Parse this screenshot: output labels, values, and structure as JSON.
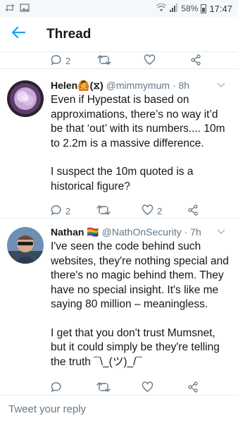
{
  "status_bar": {
    "battery": "58%",
    "time": "17:47"
  },
  "header": {
    "title": "Thread"
  },
  "top_actions": {
    "reply_count": "2"
  },
  "tweets": [
    {
      "display_name": "Helen",
      "name_suffix": "(⧖)",
      "handle": "@mimmymum",
      "time": "· 8h",
      "paragraphs": [
        "Even if Hypestat is based on approximations, there’s no way it’d be that ‘out’ with its numbers.... 10m to 2.2m is a massive difference.",
        "I suspect the 10m quoted is a historical figure?"
      ],
      "reply_count": "2",
      "like_count": "2"
    },
    {
      "display_name": "Nathan",
      "name_suffix": "🏳️‍🌈",
      "handle": "@NathOnSecurity",
      "time": "· 7h",
      "paragraphs": [
        "I've seen the code behind such websites, they're nothing special and there's no magic behind them. They have no special insight. It's like me saying 80 million – meaningless.",
        "I get that you don't trust Mumsnet, but it could simply be they're telling the truth ¯\\_(ツ)_/¯"
      ]
    }
  ],
  "reply_bar": {
    "placeholder": "Tweet your reply"
  },
  "colors": {
    "accent": "#1da1f2",
    "muted": "#657786",
    "text": "#14171a"
  }
}
